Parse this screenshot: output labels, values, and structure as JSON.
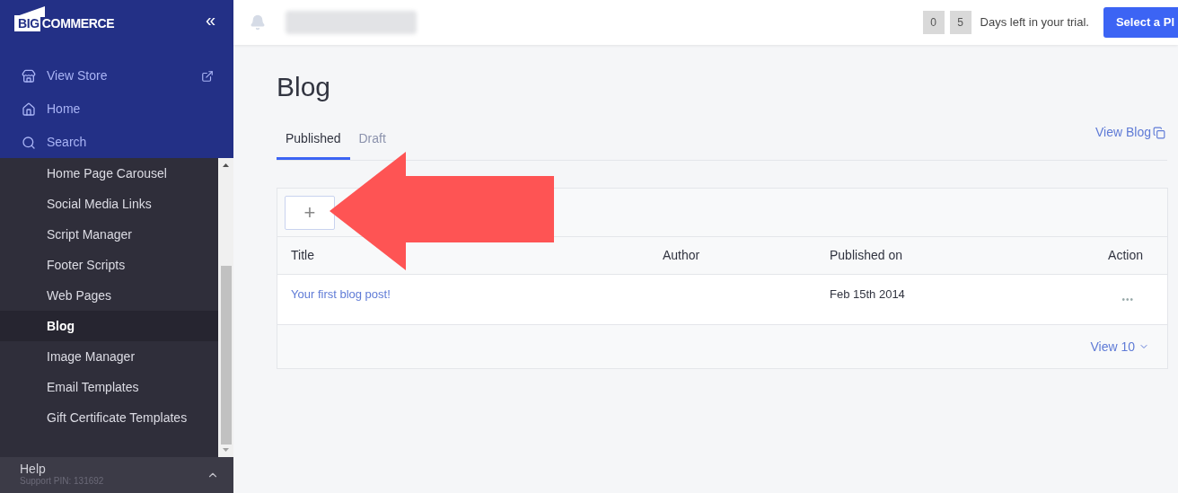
{
  "logo": {
    "mark": "BIG",
    "word": "COMMERCE"
  },
  "sidebar": {
    "collapse": "«",
    "top_items": [
      {
        "kind": "store",
        "label": "View Store"
      },
      {
        "kind": "home",
        "label": "Home"
      },
      {
        "kind": "search",
        "label": "Search"
      }
    ],
    "items": [
      {
        "label": "Home Page Carousel",
        "selected": false
      },
      {
        "label": "Social Media Links",
        "selected": false
      },
      {
        "label": "Script Manager",
        "selected": false
      },
      {
        "label": "Footer Scripts",
        "selected": false
      },
      {
        "label": "Web Pages",
        "selected": false
      },
      {
        "label": "Blog",
        "selected": true
      },
      {
        "label": "Image Manager",
        "selected": false
      },
      {
        "label": "Email Templates",
        "selected": false
      },
      {
        "label": "Gift Certificate Templates",
        "selected": false
      }
    ],
    "footer": {
      "title": "Help",
      "subtitle": "Support PIN: 131692"
    }
  },
  "header": {
    "trial_digits": [
      "0",
      "5"
    ],
    "trial_text": "Days left in your trial.",
    "plan_button": "Select a Pl"
  },
  "page": {
    "title": "Blog",
    "tabs": [
      {
        "label": "Published",
        "selected": true
      },
      {
        "label": "Draft",
        "selected": false
      }
    ],
    "view_blog": "View Blog",
    "add_button": "+",
    "table": {
      "columns": [
        "Title",
        "Author",
        "Published on",
        "Action"
      ],
      "rows": [
        {
          "title": "Your first blog post!",
          "published_on": "Feb 15th 2014",
          "action": "•••"
        }
      ],
      "footer": "View 10"
    }
  }
}
